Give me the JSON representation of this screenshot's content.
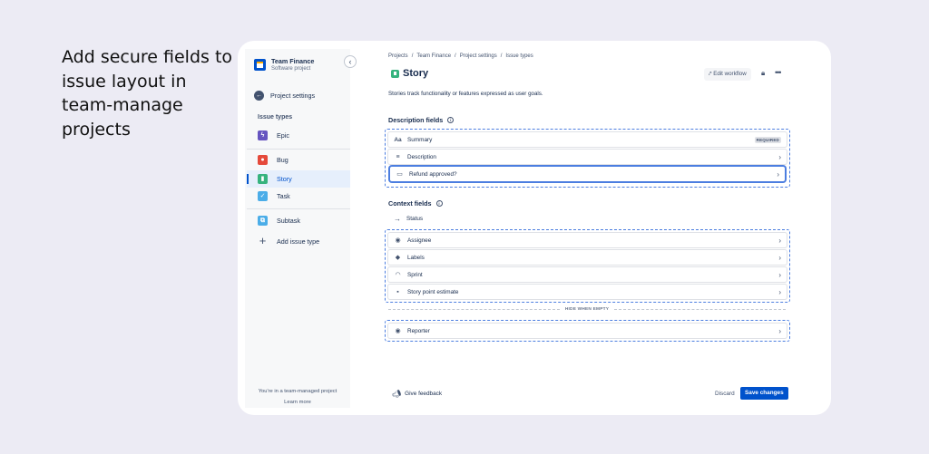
{
  "headline": "Add secure fields to issue layout in team-manage projects",
  "sidebar": {
    "project_name": "Team Finance",
    "project_type": "Software project",
    "settings_label": "Project settings",
    "section_label": "Issue types",
    "items": [
      {
        "label": "Epic",
        "icon": "lightning-icon",
        "color": "#6554c0"
      },
      {
        "label": "Bug",
        "icon": "bug-icon",
        "color": "#e5493a"
      },
      {
        "label": "Story",
        "icon": "bookmark-icon",
        "color": "#36b37e"
      },
      {
        "label": "Task",
        "icon": "check-icon",
        "color": "#4bade8"
      },
      {
        "label": "Subtask",
        "icon": "subtask-icon",
        "color": "#4bade8"
      }
    ],
    "add_label": "Add issue type",
    "footer_text": "You're in a team-managed project",
    "learn_more": "Learn more"
  },
  "breadcrumbs": [
    "Projects",
    "/",
    "Team Finance",
    "/",
    "Project settings",
    "/",
    "Issue types"
  ],
  "title": "Story",
  "edit_workflow": "Edit workflow",
  "description": "Stories track functionality or features expressed as user goals.",
  "description_fields": {
    "heading": "Description fields",
    "rows": [
      {
        "label": "Summary",
        "badge": "REQUIRED"
      },
      {
        "label": "Description"
      },
      {
        "label": "Refund approved?"
      }
    ]
  },
  "context_fields": {
    "heading": "Context fields",
    "status": "Status",
    "rows": [
      {
        "label": "Assignee"
      },
      {
        "label": "Labels"
      },
      {
        "label": "Sprint"
      },
      {
        "label": "Story point estimate"
      }
    ],
    "hide_when_empty": "HIDE WHEN EMPTY",
    "hidden_rows": [
      {
        "label": "Reporter"
      }
    ]
  },
  "footer": {
    "feedback": "Give feedback",
    "discard": "Discard",
    "save": "Save changes"
  }
}
